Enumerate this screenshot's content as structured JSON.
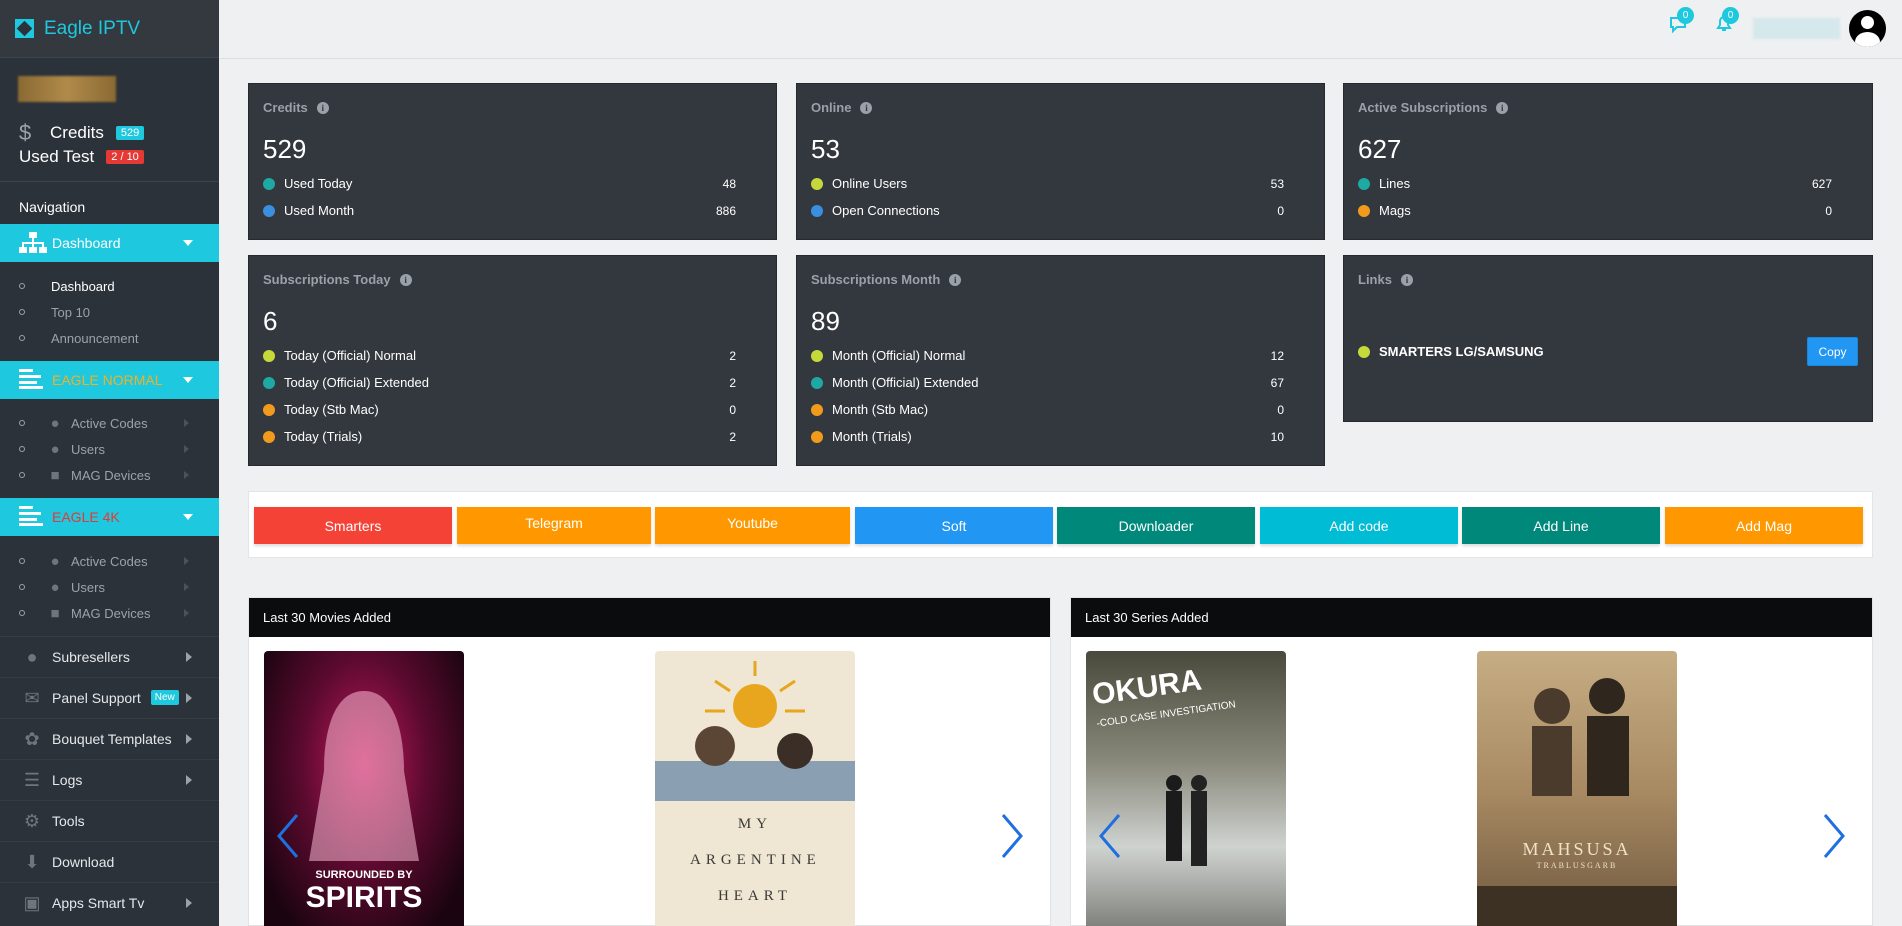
{
  "brand": {
    "name": "Eagle IPTV"
  },
  "profile": {
    "credits_label": "Credits",
    "credits_value": "529",
    "used_test_label": "Used Test",
    "used_test_value": "2 / 10"
  },
  "nav": {
    "title": "Navigation",
    "dashboard": {
      "label": "Dashboard",
      "items": [
        "Dashboard",
        "Top 10",
        "Announcement"
      ]
    },
    "eagle_normal": {
      "label": "EAGLE NORMAL",
      "color": "#f0b12a",
      "items": [
        "Active Codes",
        "Users",
        "MAG Devices"
      ]
    },
    "eagle_4k": {
      "label": "EAGLE 4K",
      "color": "#e53935",
      "items": [
        "Active Codes",
        "Users",
        "MAG Devices"
      ]
    },
    "menu": [
      {
        "label": "Subresellers",
        "icon": "users-group-icon"
      },
      {
        "label": "Panel Support",
        "icon": "envelope-icon",
        "badge": "New"
      },
      {
        "label": "Bouquet Templates",
        "icon": "bouquet-icon"
      },
      {
        "label": "Logs",
        "icon": "server-icon"
      },
      {
        "label": "Tools",
        "icon": "gear-icon"
      },
      {
        "label": "Download",
        "icon": "download-icon"
      },
      {
        "label": "Apps Smart Tv",
        "icon": "tv-icon"
      }
    ]
  },
  "topbar": {
    "messages_count": "0",
    "notifications_count": "0"
  },
  "cards": {
    "credits": {
      "title": "Credits",
      "value": "529",
      "rows": [
        {
          "label": "Used Today",
          "value": "48",
          "color": "teal"
        },
        {
          "label": "Used Month",
          "value": "886",
          "color": "blue"
        }
      ]
    },
    "online": {
      "title": "Online",
      "value": "53",
      "rows": [
        {
          "label": "Online Users",
          "value": "53",
          "color": "yellow"
        },
        {
          "label": "Open Connections",
          "value": "0",
          "color": "blue"
        }
      ]
    },
    "active": {
      "title": "Active Subscriptions",
      "value": "627",
      "rows": [
        {
          "label": "Lines",
          "value": "627",
          "color": "teal"
        },
        {
          "label": "Mags",
          "value": "0",
          "color": "orange"
        }
      ]
    },
    "sub_today": {
      "title": "Subscriptions Today",
      "value": "6",
      "rows": [
        {
          "label": "Today (Official) Normal",
          "value": "2",
          "color": "yellow"
        },
        {
          "label": "Today (Official) Extended",
          "value": "2",
          "color": "teal"
        },
        {
          "label": "Today (Stb Mac)",
          "value": "0",
          "color": "orange"
        },
        {
          "label": "Today (Trials)",
          "value": "2",
          "color": "orange"
        }
      ]
    },
    "sub_month": {
      "title": "Subscriptions Month",
      "value": "89",
      "rows": [
        {
          "label": "Month (Official) Normal",
          "value": "12",
          "color": "yellow"
        },
        {
          "label": "Month (Official) Extended",
          "value": "67",
          "color": "teal"
        },
        {
          "label": "Month (Stb Mac)",
          "value": "0",
          "color": "orange"
        },
        {
          "label": "Month (Trials)",
          "value": "10",
          "color": "orange"
        }
      ]
    },
    "links": {
      "title": "Links",
      "link_label": "SMARTERS LG/SAMSUNG",
      "copy_label": "Copy"
    }
  },
  "quick_buttons": [
    {
      "label": "Smarters",
      "color": "#f44336"
    },
    {
      "label": "Telegram",
      "color": "#ff9800"
    },
    {
      "label": "Youtube",
      "color": "#ff9800"
    },
    {
      "label": "Soft",
      "color": "#2196f3"
    },
    {
      "label": "Downloader",
      "color": "#00897b"
    },
    {
      "label": "Add code",
      "color": "#00bcd4"
    },
    {
      "label": "Add Line",
      "color": "#00897b"
    },
    {
      "label": "Add Mag",
      "color": "#ff9800"
    }
  ],
  "panels": {
    "movies": {
      "title": "Last 30 Movies Added",
      "posters": [
        {
          "text_top": "SURROUNDED BY",
          "text_main": "SPIRITS"
        },
        {
          "text_main": "MY ARGENTINE HEART"
        }
      ]
    },
    "series": {
      "title": "Last 30 Series Added",
      "posters": [
        {
          "text_main": "OKURA",
          "text_sub": "-COLD CASE INVESTIGATION"
        },
        {
          "text_main": "MAHSUSA",
          "text_sub": "TRABLUSGARB"
        }
      ]
    }
  }
}
